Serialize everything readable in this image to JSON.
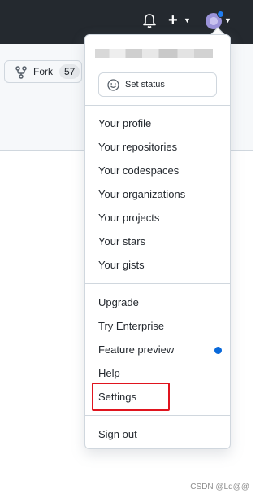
{
  "header": {
    "icons": [
      "bell-icon",
      "plus-icon",
      "caret-down-icon",
      "avatar",
      "caret-down-icon"
    ],
    "plus_label": "+",
    "notification_dot_color": "#1f7cf0"
  },
  "repo_actions": {
    "fork_label": "Fork",
    "fork_count": "57"
  },
  "menu": {
    "status_label": "Set status",
    "groups": [
      [
        "Your profile",
        "Your repositories",
        "Your codespaces",
        "Your organizations",
        "Your projects",
        "Your stars",
        "Your gists"
      ],
      [
        "Upgrade",
        "Try Enterprise",
        "Feature preview",
        "Help",
        "Settings"
      ],
      [
        "Sign out"
      ]
    ],
    "highlighted_item": "Settings",
    "highlight_color": "#e0141e",
    "feature_preview_dot_color": "#0969da"
  },
  "watermark": "CSDN @Lq@@"
}
